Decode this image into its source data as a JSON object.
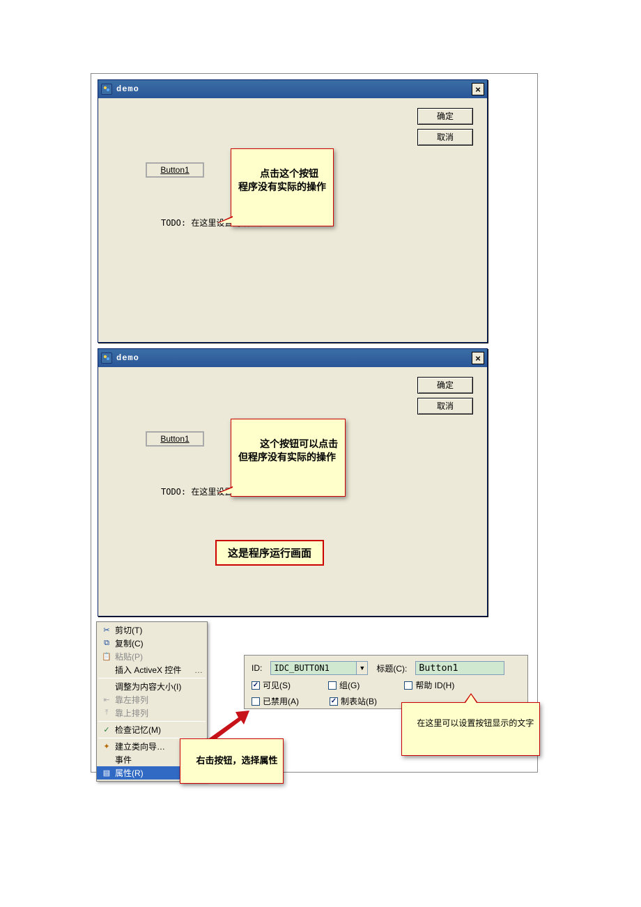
{
  "dialog1": {
    "title": "demo",
    "btn1_label": "Button1",
    "ok_label": "确定",
    "cancel_label": "取消",
    "todo_text": "TODO: 在这里设置对话控制。",
    "callout": "点击这个按钮\n程序没有实际的操作"
  },
  "dialog2": {
    "title": "demo",
    "btn1_label": "Button1",
    "ok_label": "确定",
    "cancel_label": "取消",
    "todo_text": "TODO: 在这里设置对话控制。",
    "callout": "这个按钮可以点击\n但程序没有实际的操作",
    "runtime_caption": "这是程序运行画面"
  },
  "context_menu": {
    "cut": "剪切(T)",
    "copy": "复制(C)",
    "paste": "粘贴(P)",
    "insert_activex": "插入 ActiveX 控件",
    "size_to_content": "调整为内容大小(I)",
    "align_left": "靠左排列",
    "align_top": "靠上排列",
    "check_mnemonics": "检查记忆(M)",
    "class_wizard": "建立类向导…",
    "events": "事件",
    "properties": "属性(R)"
  },
  "menu_callout": "右击按钮，选择属性",
  "props": {
    "id_label": "ID:",
    "id_value": "IDC_BUTTON1",
    "caption_label": "标题(C):",
    "caption_value": "Button1",
    "visible_label": "可见(S)",
    "group_label": "组(G)",
    "helpid_label": "帮助 ID(H)",
    "disabled_label": "已禁用(A)",
    "tabstop_label": "制表站(B)",
    "caption_hint": "在这里可以设置按钮显示的文字"
  }
}
